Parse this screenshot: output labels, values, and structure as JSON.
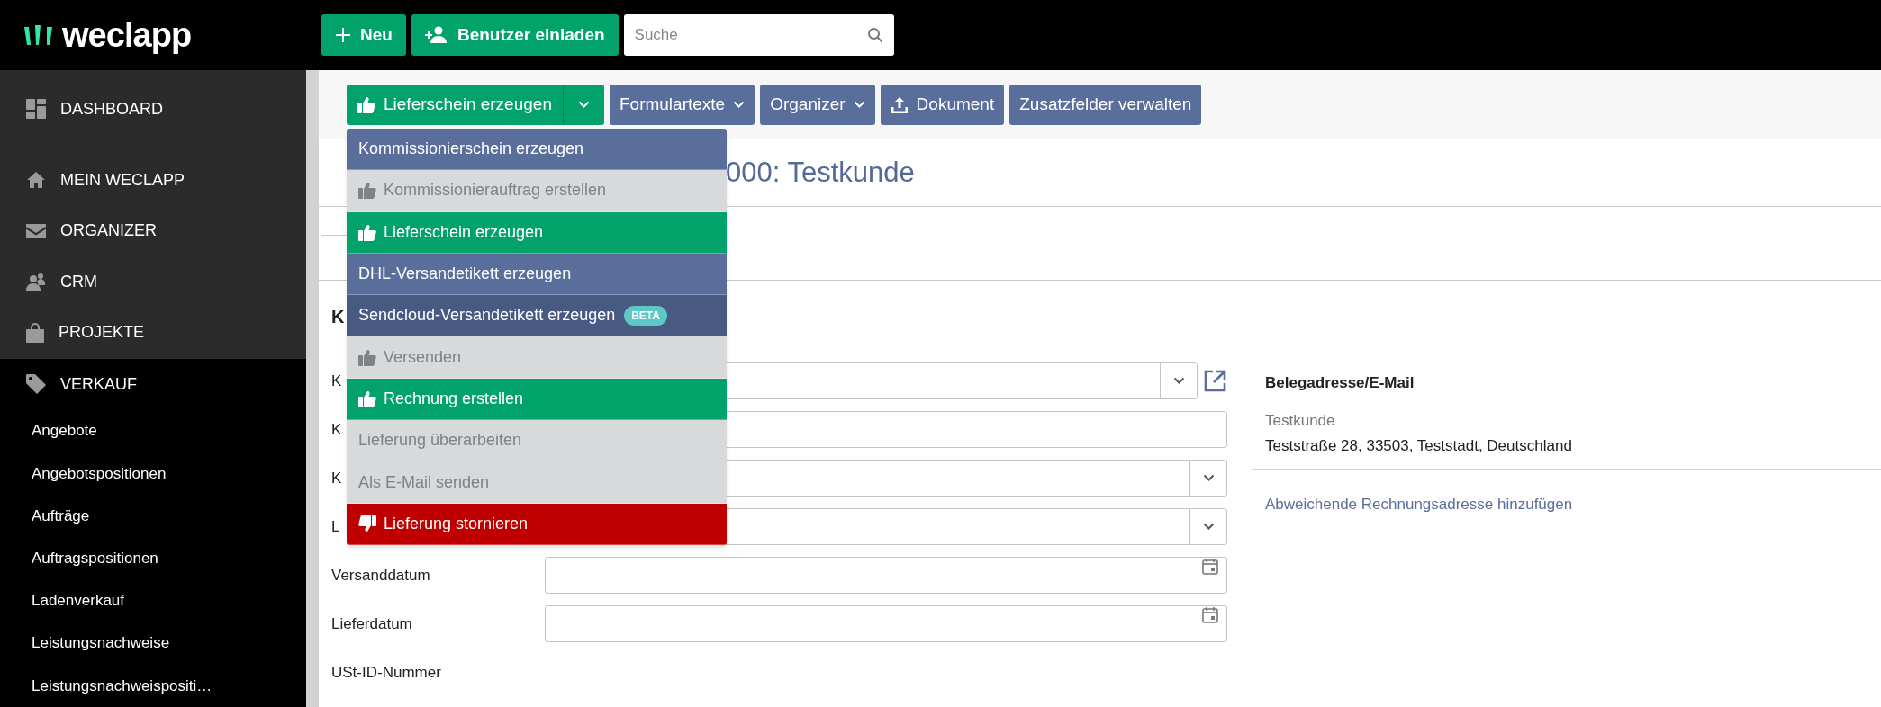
{
  "logo": {
    "text": "weclapp"
  },
  "top_buttons": [
    {
      "label": "Neu",
      "kind": "new"
    },
    {
      "label": "Benutzer einladen",
      "kind": "invite"
    }
  ],
  "search": {
    "placeholder": "Suche"
  },
  "sidebar": {
    "items": [
      {
        "label": "DASHBOARD",
        "expanded": false
      },
      {
        "label": "MEIN WECLAPP",
        "expanded": false
      },
      {
        "label": "ORGANIZER",
        "expanded": false
      },
      {
        "label": "CRM",
        "expanded": false
      },
      {
        "label": "PROJEKTE",
        "expanded": false
      },
      {
        "label": "VERKAUF",
        "expanded": true,
        "children": [
          {
            "label": "Angebote"
          },
          {
            "label": "Angebotspositionen"
          },
          {
            "label": "Aufträge"
          },
          {
            "label": "Auftragspositionen"
          },
          {
            "label": "Ladenverkauf"
          },
          {
            "label": "Leistungsnachweise"
          },
          {
            "label": "Leistungsnachweispositi…"
          }
        ]
      }
    ]
  },
  "toolbar": {
    "split_button": {
      "label": "Lieferschein erzeugen"
    },
    "buttons": [
      {
        "label": "Formulartexte",
        "kind": "menu"
      },
      {
        "label": "Organizer",
        "kind": "menu"
      },
      {
        "label": "Dokument",
        "kind": "upload"
      },
      {
        "label": "Zusatzfelder verwalten",
        "kind": "plain"
      }
    ]
  },
  "menu": {
    "items": [
      {
        "label": "Kommissionierschein erzeugen",
        "kind": "info",
        "highlighted": false
      },
      {
        "label": "Kommissionierauftrag erstellen",
        "kind": "disabled",
        "thumb": true,
        "highlighted": false
      },
      {
        "label": "Lieferschein erzeugen",
        "kind": "success",
        "thumb": true,
        "highlighted": false
      },
      {
        "label": "DHL-Versandetikett erzeugen",
        "kind": "info",
        "highlighted": false
      },
      {
        "label": "Sendcloud-Versandetikett erzeugen",
        "kind": "info",
        "badge": "BETA",
        "highlighted": true
      },
      {
        "label": "Versenden",
        "kind": "disabled",
        "thumb": true,
        "highlighted": false
      },
      {
        "label": "Rechnung erstellen",
        "kind": "success",
        "thumb": true,
        "highlighted": false
      },
      {
        "label": "Lieferung überarbeiten",
        "kind": "disabled",
        "highlighted": false
      },
      {
        "label": "Als E-Mail senden",
        "kind": "disabled",
        "highlighted": false
      },
      {
        "label": "Lieferung stornieren",
        "kind": "danger",
        "thumb": true,
        "highlighted": false
      }
    ]
  },
  "title": "000: Testkunde",
  "form": {
    "heading": "K",
    "rows": [
      {
        "label": "K",
        "kind": "combo"
      },
      {
        "label": "K",
        "kind": "text"
      },
      {
        "label": "K",
        "kind": "select"
      },
      {
        "label": "L",
        "kind": "select"
      },
      {
        "label": "Versanddatum",
        "kind": "date"
      },
      {
        "label": "Lieferdatum",
        "kind": "date"
      },
      {
        "label": "USt-ID-Nummer",
        "kind": "label"
      }
    ]
  },
  "address": {
    "heading": "Belegadresse/E-Mail",
    "name": "Testkunde",
    "line": "Teststraße 28, 33503, Teststadt, Deutschland",
    "link": "Abweichende Rechnungsadresse hinzufügen"
  }
}
